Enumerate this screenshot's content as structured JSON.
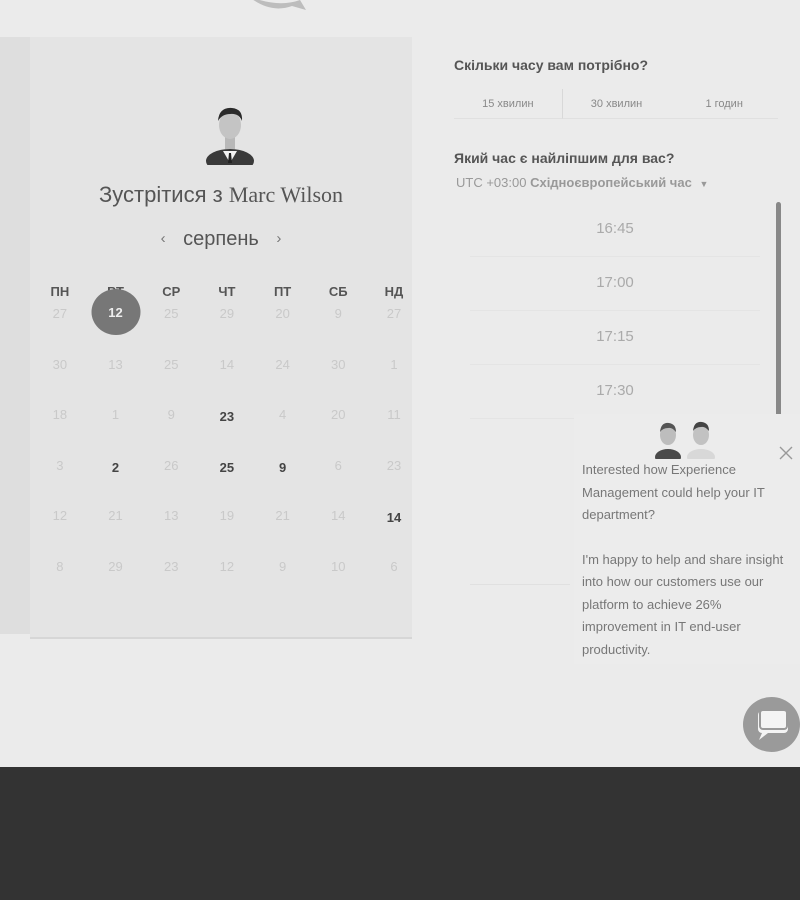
{
  "host": {
    "title_prefix": "Зустрітися з",
    "name": "Marc Wilson"
  },
  "calendar": {
    "month": "серпень",
    "weekdays": [
      "ПН",
      "ВТ",
      "СР",
      "ЧТ",
      "ПТ",
      "СБ",
      "НД"
    ],
    "selected_day": "12",
    "rows": [
      [
        "27",
        "12",
        "25",
        "29",
        "20",
        "9",
        "27"
      ],
      [
        "30",
        "13",
        "25",
        "14",
        "24",
        "30",
        "1"
      ],
      [
        "18",
        "1",
        "9",
        "23",
        "4",
        "20",
        "11"
      ],
      [
        "3",
        "2",
        "26",
        "25",
        "9",
        "6",
        "23"
      ],
      [
        "12",
        "21",
        "13",
        "19",
        "21",
        "14",
        "14"
      ],
      [
        "8",
        "29",
        "23",
        "12",
        "9",
        "10",
        "6"
      ]
    ],
    "available": [
      [
        2,
        3
      ],
      [
        3,
        1
      ],
      [
        3,
        3
      ],
      [
        3,
        4
      ],
      [
        4,
        6
      ]
    ]
  },
  "duration": {
    "question": "Скільки часу вам потрібно?",
    "options": [
      "15 хвилин",
      "30 хвилин",
      "1 годин"
    ]
  },
  "time": {
    "question": "Який час є найліпшим для вас?",
    "timezone_offset": "UTC +03:00",
    "timezone_name": "Східноєвропейський час",
    "slots": [
      "16:45",
      "17:00",
      "17:15",
      "17:30"
    ]
  },
  "popup": {
    "message1": "Interested how Experience Management could help your IT department?",
    "message2": "I'm happy to help and share insight into how our customers use our platform to achieve 26% improvement in IT end-user productivity."
  }
}
